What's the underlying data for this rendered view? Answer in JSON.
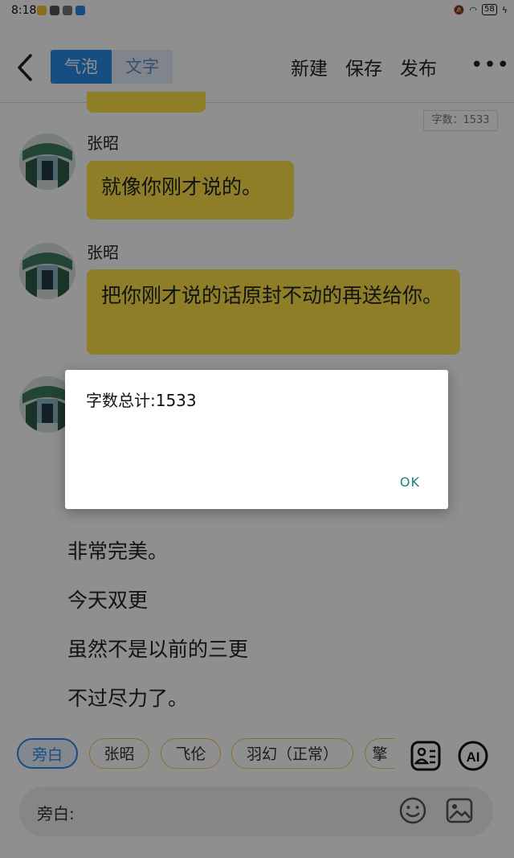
{
  "status": {
    "time": "8:18",
    "battery": "58"
  },
  "appbar": {
    "mode_bubble": "气泡",
    "mode_text": "文字",
    "actions": [
      "新建",
      "保存",
      "发布"
    ],
    "more": "•••"
  },
  "word_count_badge": "字数：1533",
  "messages": [
    {
      "speaker": "张昭",
      "text": "就像你刚才说的。"
    },
    {
      "speaker": "张昭",
      "text": "把你刚才说的话原封不动的再送给你。"
    }
  ],
  "narration": [
    "非常完美。",
    "今天双更",
    "虽然不是以前的三更",
    "不过尽力了。"
  ],
  "chips": [
    "旁白",
    "张昭",
    "飞伦",
    "羽幻（正常）",
    "擎"
  ],
  "input": {
    "label": "旁白:"
  },
  "dialog": {
    "message": "字数总计:1533",
    "ok": "OK"
  },
  "colors": {
    "accent": "#2a8be8",
    "bubble": "#fde047",
    "chip_border": "#f2c55a",
    "dialog_button": "#1b8080"
  }
}
